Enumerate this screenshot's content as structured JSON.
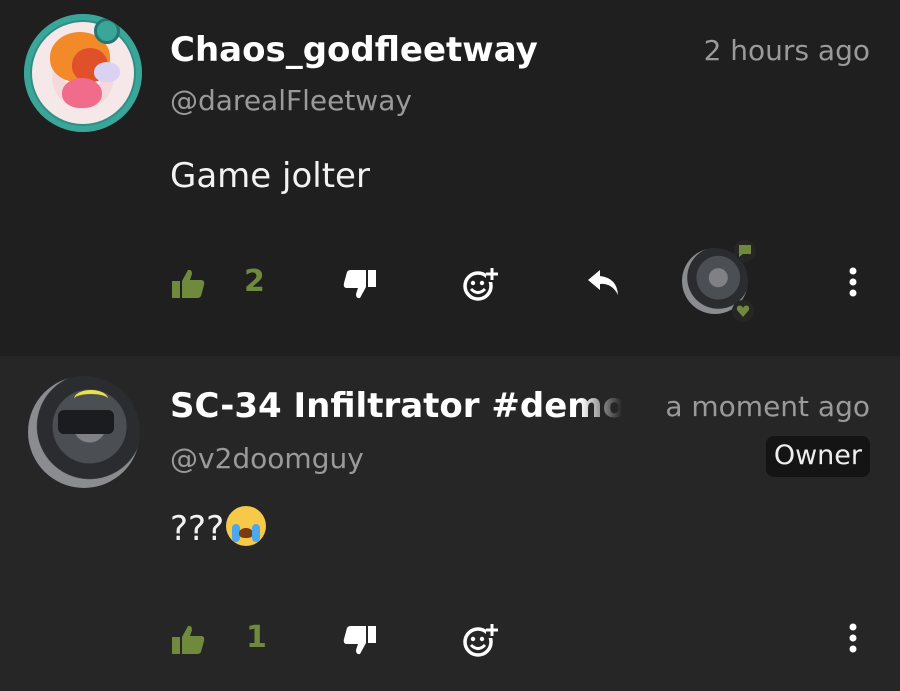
{
  "colors": {
    "background": "#1e1e1e",
    "comment_highlight": "#262626",
    "accent_green": "#6f8a3d",
    "muted_text": "#9a9a9a"
  },
  "comments": [
    {
      "author": "Chaos_godfleetway",
      "handle": "@darealFleetway",
      "time": "2 hours ago",
      "text": "Game jolter",
      "likes": "2",
      "actions": [
        "thumbs-up-icon",
        "thumbs-down-icon",
        "add-reaction-icon",
        "reply-icon",
        "more-options-icon"
      ],
      "reply_avatar_badges": [
        "chat-bubble-icon",
        "heart-icon"
      ]
    },
    {
      "author": "SC-34 Infiltrator #demo",
      "handle": "@v2doomguy",
      "time": "a moment ago",
      "badge": "Owner",
      "text": "???",
      "emoji": "loudly-crying-face",
      "likes": "1",
      "actions": [
        "thumbs-up-icon",
        "thumbs-down-icon",
        "add-reaction-icon",
        "more-options-icon"
      ]
    }
  ]
}
